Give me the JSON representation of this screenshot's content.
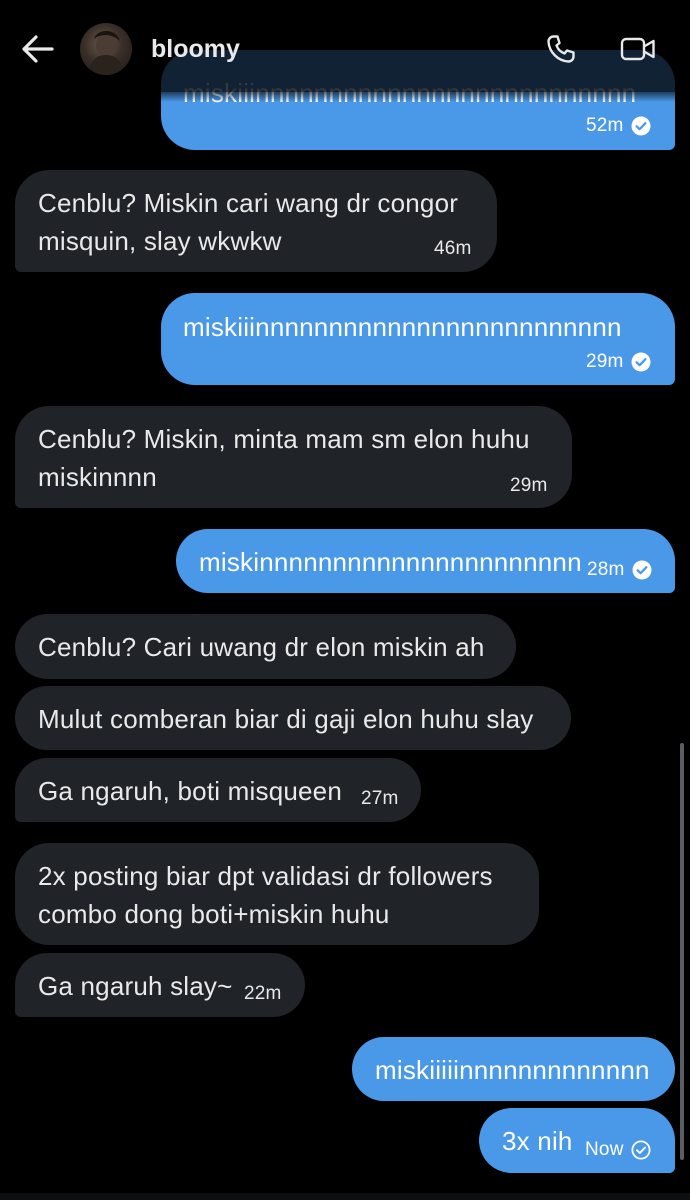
{
  "header": {
    "back_icon": "arrow-left-icon",
    "username": "bloomy",
    "call_icon": "phone-icon",
    "video_icon": "video-camera-icon"
  },
  "colors": {
    "background": "#000000",
    "incoming_bubble": "#202327",
    "outgoing_bubble": "#4a99e9",
    "text": "#e7e9ea"
  },
  "messages": [
    {
      "dir": "out",
      "text": "miskiiinnnnnnnnnnnnnnnnnnnnnnnnnn",
      "time": "52m",
      "seen": true
    },
    {
      "dir": "in",
      "text": "Cenblu? Miskin cari wang dr congor misquin, slay wkwkw",
      "time": "46m"
    },
    {
      "dir": "out",
      "text": "miskiiinnnnnnnnnnnnnnnnnnnnnnnnn",
      "time": "29m",
      "seen": true
    },
    {
      "dir": "in",
      "text": "Cenblu? Miskin, minta mam sm elon huhu miskinnnn",
      "time": "29m"
    },
    {
      "dir": "out",
      "text": "miskinnnnnnnnnnnnnnnnnnnnnn",
      "time": "28m",
      "seen": true
    },
    {
      "dir": "in",
      "text": "Cenblu? Cari uwang dr elon miskin ah",
      "time": ""
    },
    {
      "dir": "in",
      "text": "Mulut comberan biar di gaji elon huhu slay",
      "time": ""
    },
    {
      "dir": "in",
      "text": "Ga ngaruh, boti misqueen",
      "time": "27m"
    },
    {
      "dir": "in",
      "text": "2x posting biar dpt validasi dr followers combo dong boti+miskin huhu",
      "time": ""
    },
    {
      "dir": "in",
      "text": "Ga ngaruh slay~",
      "time": "22m"
    },
    {
      "dir": "out",
      "text": "miskiiiiinnnnnnnnnnnnn",
      "time": ""
    },
    {
      "dir": "out",
      "text": "3x nih",
      "time": "Now",
      "seen": true,
      "sent_only": true
    }
  ]
}
